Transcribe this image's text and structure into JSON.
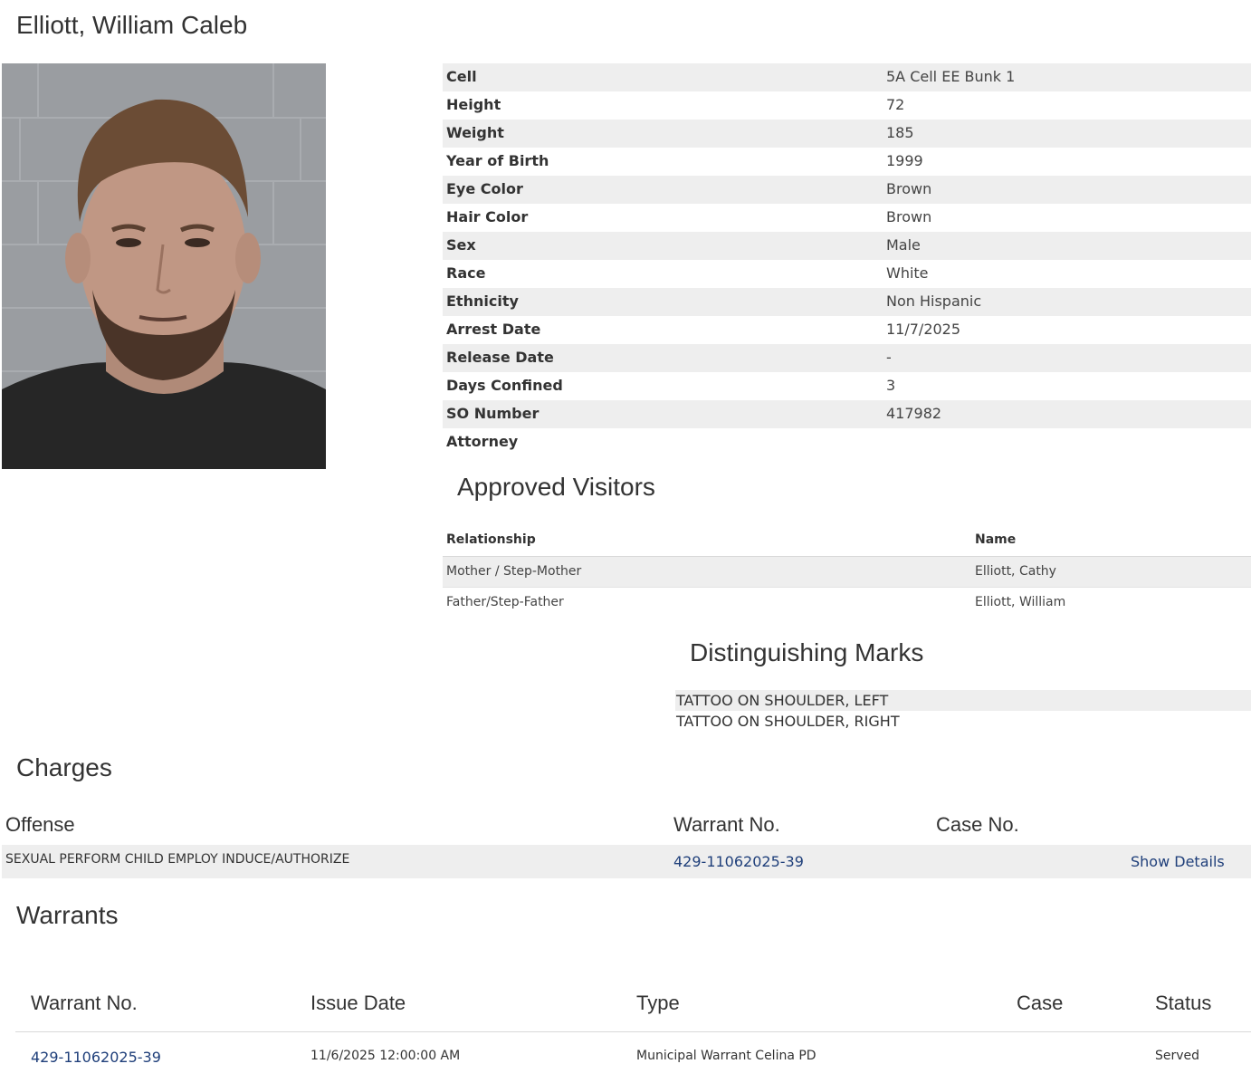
{
  "inmate": {
    "name": "Elliott, William Caleb",
    "photo_icon": "mugshot-photo"
  },
  "details": [
    {
      "label": "Cell",
      "value": "5A Cell EE Bunk 1"
    },
    {
      "label": "Height",
      "value": "72"
    },
    {
      "label": "Weight",
      "value": "185"
    },
    {
      "label": "Year of Birth",
      "value": "1999"
    },
    {
      "label": "Eye Color",
      "value": "Brown"
    },
    {
      "label": "Hair Color",
      "value": "Brown"
    },
    {
      "label": "Sex",
      "value": "Male"
    },
    {
      "label": "Race",
      "value": "White"
    },
    {
      "label": "Ethnicity",
      "value": "Non Hispanic"
    },
    {
      "label": "Arrest Date",
      "value": "11/7/2025"
    },
    {
      "label": "Release Date",
      "value": "-"
    },
    {
      "label": "Days Confined",
      "value": "3"
    },
    {
      "label": "SO Number",
      "value": "417982"
    },
    {
      "label": "Attorney",
      "value": ""
    }
  ],
  "visitors": {
    "title": "Approved Visitors",
    "headers": {
      "relationship": "Relationship",
      "name": "Name"
    },
    "rows": [
      {
        "relationship": "Mother / Step-Mother",
        "name": "Elliott, Cathy"
      },
      {
        "relationship": "Father/Step-Father",
        "name": "Elliott, William"
      }
    ]
  },
  "marks": {
    "title": "Distinguishing Marks",
    "items": [
      "TATTOO ON SHOULDER, LEFT",
      "TATTOO ON SHOULDER, RIGHT"
    ]
  },
  "charges": {
    "title": "Charges",
    "headers": {
      "offense": "Offense",
      "warrant": "Warrant No.",
      "case": "Case No."
    },
    "rows": [
      {
        "offense": "SEXUAL PERFORM CHILD EMPLOY INDUCE/AUTHORIZE",
        "warrant": "429-11062025-39",
        "case": "",
        "details_label": "Show Details"
      }
    ]
  },
  "warrants": {
    "title": "Warrants",
    "headers": {
      "warrant": "Warrant No.",
      "issue_date": "Issue Date",
      "type": "Type",
      "case": "Case",
      "status": "Status"
    },
    "rows": [
      {
        "warrant": "429-11062025-39",
        "issue_date": "11/6/2025 12:00:00 AM",
        "type": "Municipal Warrant Celina PD",
        "case": "",
        "status": "Served"
      }
    ]
  },
  "colors": {
    "link": "#1f3f7a",
    "row_shade": "#eeeeee",
    "text": "#333333"
  }
}
